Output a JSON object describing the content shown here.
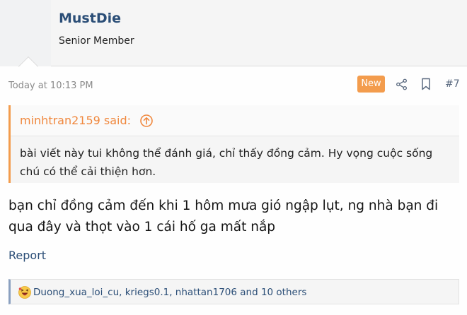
{
  "user": {
    "name": "MustDie",
    "title": "Senior Member"
  },
  "meta": {
    "time": "Today at 10:13 PM",
    "badge": "New",
    "post_number": "#7",
    "share_icon": "share-icon",
    "bookmark_icon": "bookmark-icon"
  },
  "quote": {
    "author": "minhtran2159 said:",
    "arrow_icon": "arrow-up-circle-icon",
    "text": "bài viết này tui không thể đánh giá, chỉ thấy đồng cảm. Hy vọng cuộc sống chú có thể cải thiện hơn."
  },
  "post": {
    "body": "bạn chỉ đồng cảm đến khi 1 hôm mưa gió ngập lụt, ng nhà bạn đi qua đây và thọt vào 1 cái hố ga mất nắp"
  },
  "actions": {
    "report": "Report"
  },
  "reactions": {
    "icon": "haha-emoji-icon",
    "text": "Duong_xua_loi_cu, kriegs0.1, nhattan1706 and 10 others"
  },
  "colors": {
    "accent": "#f39c4d",
    "link": "#2b4e77",
    "muted": "#8a8a8a"
  }
}
